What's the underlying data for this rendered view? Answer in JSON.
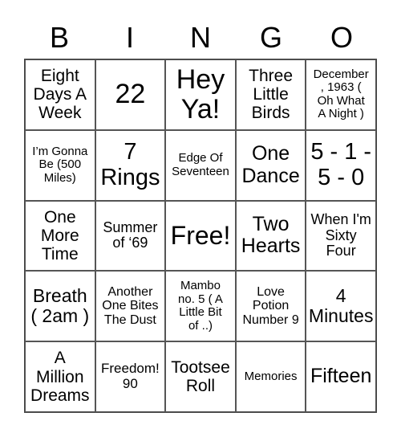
{
  "header": [
    "B",
    "I",
    "N",
    "G",
    "O"
  ],
  "cells": [
    "Eight\nDays A\nWeek",
    "22",
    "Hey\nYa!",
    "Three\nLittle\nBirds",
    "December\n, 1963 (\nOh What\nA Night )",
    "I’m Gonna\nBe (500\nMiles)",
    "7\nRings",
    "Edge Of\nSeventeen",
    "One\nDance",
    "5 - 1 -\n5 - 0",
    "One\nMore\nTime",
    "Summer\nof ‘69",
    "Free!",
    "Two\nHearts",
    "When I'm\nSixty\nFour",
    "Breath\n( 2am )",
    "Another\nOne Bites\nThe Dust",
    "Mambo\nno. 5 ( A\nLittle Bit\nof ..)",
    "Love\nPotion\nNumber 9",
    "4\nMinutes",
    "A\nMillion\nDreams",
    "Freedom!\n90",
    "Tootsee\nRoll",
    "Memories",
    "Fifteen"
  ]
}
